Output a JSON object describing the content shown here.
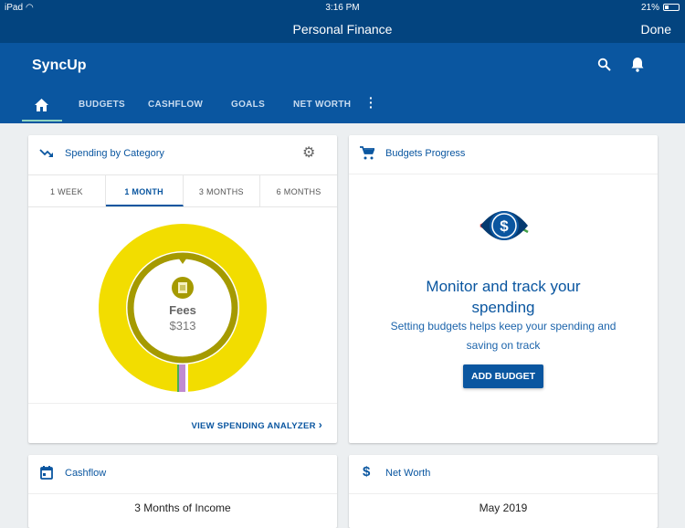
{
  "status_bar": {
    "device": "iPad",
    "time": "3:16 PM",
    "battery": "21%"
  },
  "nav_bar": {
    "title": "Personal Finance",
    "done_label": "Done"
  },
  "app_bar": {
    "brand": "SyncUp",
    "icons": [
      "search-icon",
      "bell-icon"
    ]
  },
  "tabs": [
    {
      "icon": "home-icon",
      "active": true
    },
    {
      "label": "BUDGETS"
    },
    {
      "label": "CASHFLOW"
    },
    {
      "label": "GOALS"
    },
    {
      "label": "NET WORTH"
    }
  ],
  "spending": {
    "title": "Spending by Category",
    "periods": [
      "1 WEEK",
      "1 MONTH",
      "3 MONTHS",
      "6 MONTHS"
    ],
    "selected_period": "1 MONTH",
    "selected_category": "Fees",
    "selected_amount": "$313",
    "link": "VIEW SPENDING ANALYZER",
    "colors": {
      "fees": "#f2dd00",
      "ring": "#a59a00"
    }
  },
  "budgets": {
    "title": "Budgets Progress",
    "heading": "Monitor and track your spending",
    "body": "Setting budgets helps keep your spending and saving on track",
    "button": "ADD BUDGET"
  },
  "cashflow": {
    "title": "Cashflow",
    "subtitle": "3 Months of Income"
  },
  "net_worth": {
    "title": "Net Worth",
    "subtitle": "May 2019"
  },
  "colors": {
    "primary": "#0a56a0",
    "dark": "#03447f"
  }
}
